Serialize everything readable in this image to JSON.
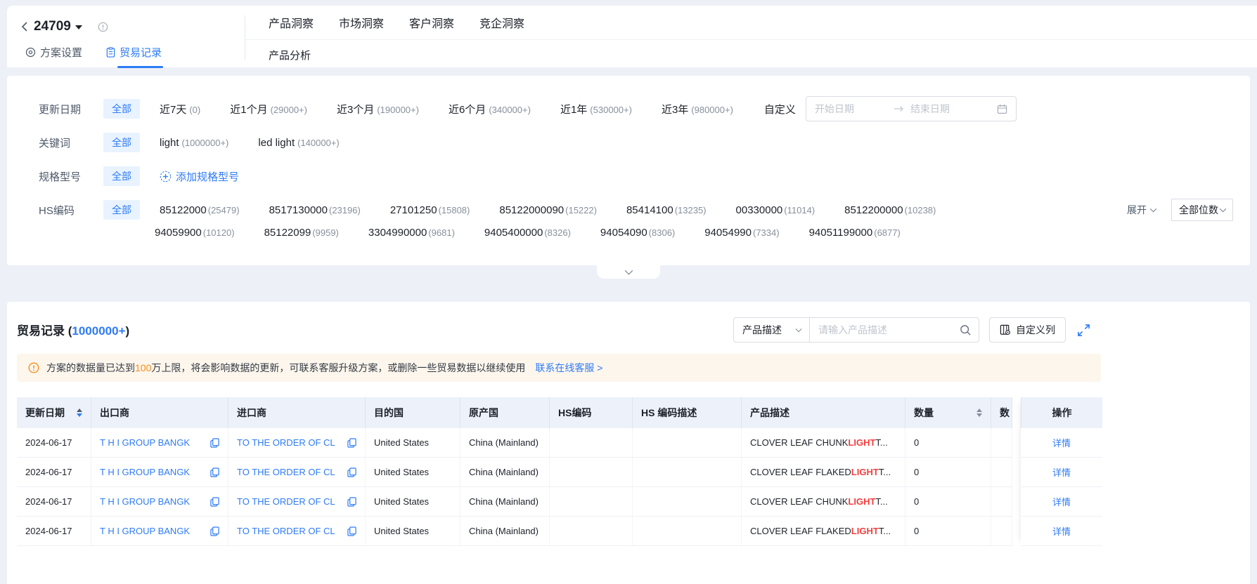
{
  "colors": {
    "primary": "#2e7bf6",
    "highlight_red": "#f53f3f",
    "warning_orange": "#fa8c16"
  },
  "header": {
    "plan_id": "24709",
    "tabs": {
      "settings": "方案设置",
      "records": "贸易记录"
    },
    "nav": {
      "items": [
        {
          "label": "产品洞察"
        },
        {
          "label": "市场洞察"
        },
        {
          "label": "客户洞察"
        },
        {
          "label": "竞企洞察"
        }
      ],
      "sub": "产品分析"
    }
  },
  "filters": {
    "update_date": {
      "label": "更新日期",
      "all": "全部",
      "options": [
        {
          "n": "近7天",
          "c": "(0)"
        },
        {
          "n": "近1个月",
          "c": "(29000+)"
        },
        {
          "n": "近3个月",
          "c": "(190000+)"
        },
        {
          "n": "近6个月",
          "c": "(340000+)"
        },
        {
          "n": "近1年",
          "c": "(530000+)"
        },
        {
          "n": "近3年",
          "c": "(980000+)"
        }
      ],
      "custom": "自定义",
      "start_placeholder": "开始日期",
      "end_placeholder": "结束日期"
    },
    "keyword": {
      "label": "关键词",
      "all": "全部",
      "options": [
        {
          "n": "light",
          "c": "(1000000+)"
        },
        {
          "n": "led light",
          "c": "(140000+)"
        }
      ]
    },
    "spec": {
      "label": "规格型号",
      "all": "全部",
      "add": "添加规格型号"
    },
    "hs": {
      "label": "HS编码",
      "all": "全部",
      "row1": [
        {
          "code": "85122000",
          "c": "(25479)"
        },
        {
          "code": "8517130000",
          "c": "(23196)"
        },
        {
          "code": "27101250",
          "c": "(15808)"
        },
        {
          "code": "85122000090",
          "c": "(15222)"
        },
        {
          "code": "85414100",
          "c": "(13235)"
        },
        {
          "code": "00330000",
          "c": "(11014)"
        },
        {
          "code": "8512200000",
          "c": "(10238)"
        }
      ],
      "row2": [
        {
          "code": "94059900",
          "c": "(10120)"
        },
        {
          "code": "85122099",
          "c": "(9959)"
        },
        {
          "code": "3304990000",
          "c": "(9681)"
        },
        {
          "code": "9405400000",
          "c": "(8326)"
        },
        {
          "code": "94054090",
          "c": "(8306)"
        },
        {
          "code": "94054990",
          "c": "(7334)"
        },
        {
          "code": "94051199000",
          "c": "(6877)"
        }
      ],
      "expand": "展开",
      "digits": "全部位数"
    }
  },
  "records": {
    "title_pre": "贸易记录 (",
    "count": "1000000+",
    "title_post": ")",
    "search_field": "产品描述",
    "search_placeholder": "请输入产品描述",
    "custom_cols": "自定义列",
    "notice": {
      "pre": "方案的数据量已达到",
      "num": "100",
      "post": "万上限，将会影响数据的更新，可联系客服升级方案，或删除一些贸易数据以继续使用",
      "link": "联系在线客服 >"
    },
    "table": {
      "headers": [
        "更新日期",
        "出口商",
        "进口商",
        "目的国",
        "原产国",
        "HS编码",
        "HS 编码描述",
        "产品描述",
        "数量",
        "数",
        "操作"
      ],
      "rows": [
        {
          "date": "2024-06-17",
          "exporter": "T H I GROUP BANGK",
          "importer": "TO THE ORDER OF CL",
          "dest": "United States",
          "origin": "China (Mainland)",
          "hs": "",
          "hs_desc": "",
          "p_pre": "CLOVER LEAF CHUNK ",
          "p_hl": "LIGHT",
          "p_post": " T...",
          "qty": "0",
          "action": "详情"
        },
        {
          "date": "2024-06-17",
          "exporter": "T H I GROUP BANGK",
          "importer": "TO THE ORDER OF CL",
          "dest": "United States",
          "origin": "China (Mainland)",
          "hs": "",
          "hs_desc": "",
          "p_pre": "CLOVER LEAF FLAKED ",
          "p_hl": "LIGHT",
          "p_post": " T...",
          "qty": "0",
          "action": "详情"
        },
        {
          "date": "2024-06-17",
          "exporter": "T H I GROUP BANGK",
          "importer": "TO THE ORDER OF CL",
          "dest": "United States",
          "origin": "China (Mainland)",
          "hs": "",
          "hs_desc": "",
          "p_pre": "CLOVER LEAF CHUNK ",
          "p_hl": "LIGHT",
          "p_post": " T...",
          "qty": "0",
          "action": "详情"
        },
        {
          "date": "2024-06-17",
          "exporter": "T H I GROUP BANGK",
          "importer": "TO THE ORDER OF CL",
          "dest": "United States",
          "origin": "China (Mainland)",
          "hs": "",
          "hs_desc": "",
          "p_pre": "CLOVER LEAF FLAKED ",
          "p_hl": "LIGHT",
          "p_post": " T...",
          "qty": "0",
          "action": "详情"
        }
      ]
    }
  }
}
